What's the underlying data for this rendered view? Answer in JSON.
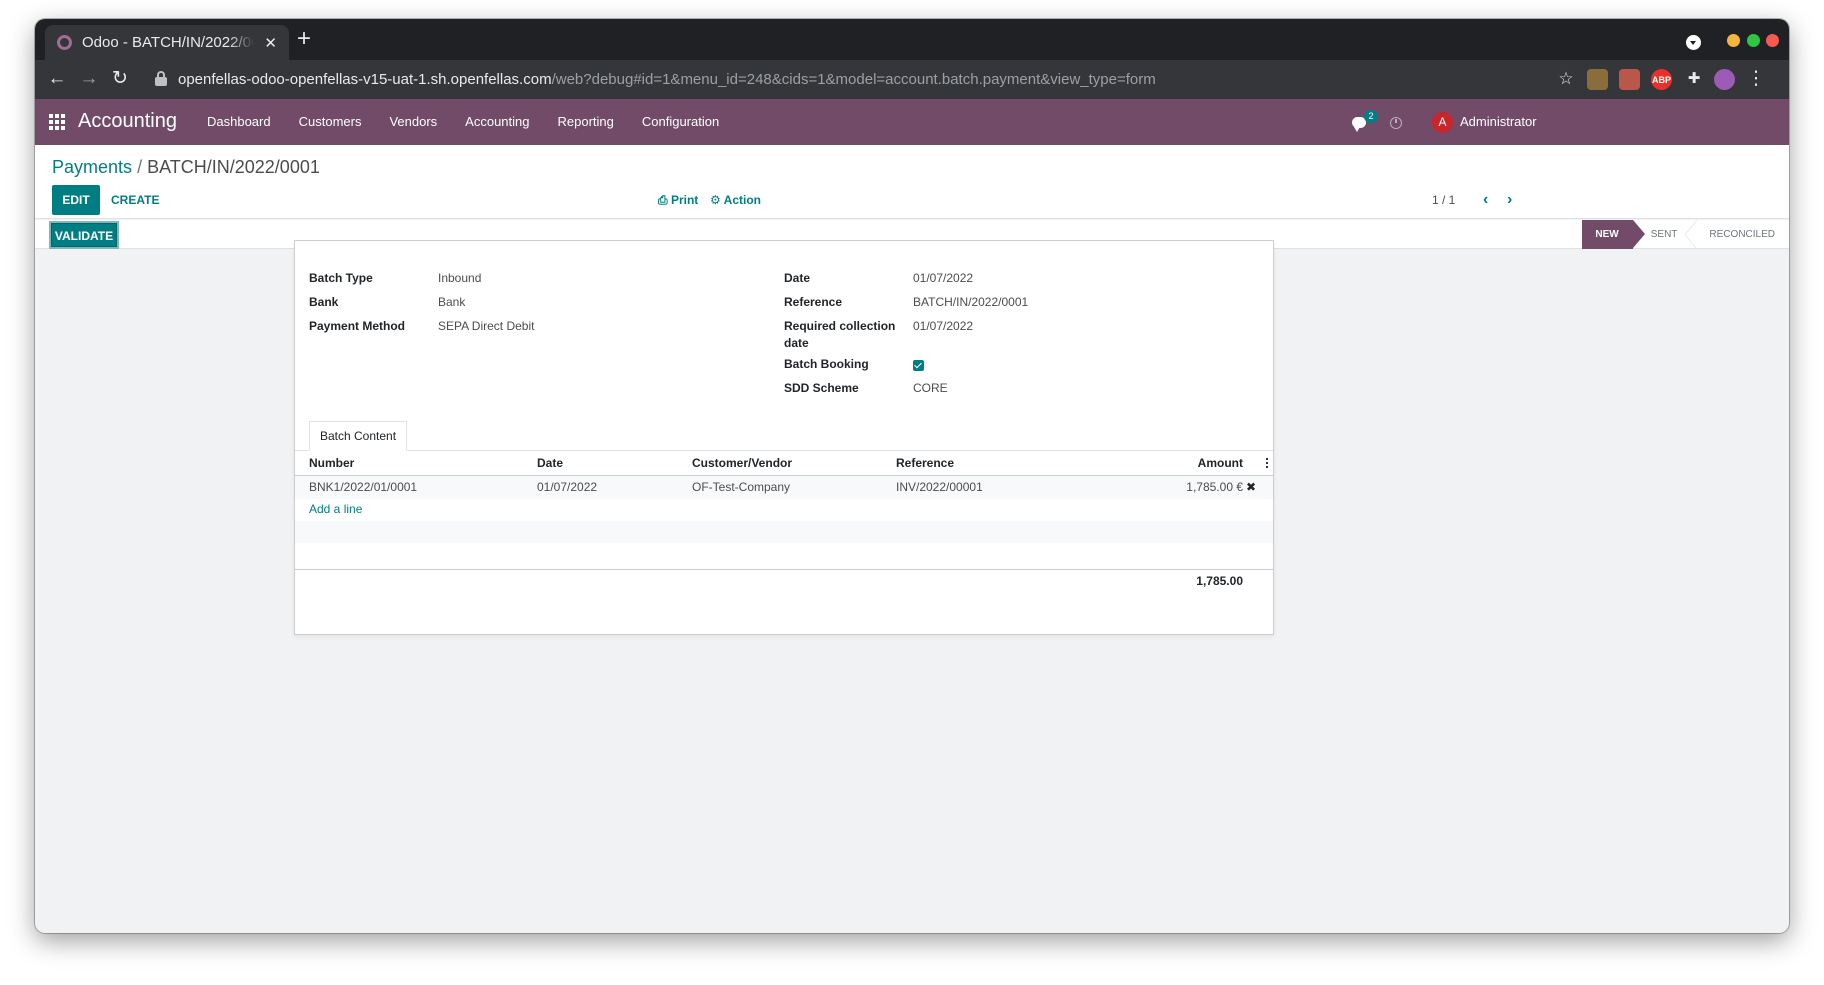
{
  "browser": {
    "tab_title": "Odoo - BATCH/IN/2022/0001",
    "url_host": "openfellas-odoo-openfellas-v15-uat-1.sh.openfellas.com",
    "url_path": "/web?debug#id=1&menu_id=248&cids=1&model=account.batch.payment&view_type=form",
    "extensions": [
      {
        "name": "extension-1-icon",
        "color": "#8a6d3b"
      },
      {
        "name": "extension-2-icon",
        "color": "#b8574a"
      },
      {
        "name": "adblock-icon",
        "label": "ABP",
        "color": "#e5322d"
      },
      {
        "name": "extensions-puzzle-icon",
        "color": "transparent"
      },
      {
        "name": "profile-avatar-icon",
        "color": "#9c5bb5"
      }
    ],
    "traffic_light_colors": [
      "#f5b43b",
      "#2fc642",
      "#f45a52"
    ]
  },
  "navbar": {
    "app_name": "Accounting",
    "menu": [
      "Dashboard",
      "Customers",
      "Vendors",
      "Accounting",
      "Reporting",
      "Configuration"
    ],
    "message_count": "2",
    "user_initial": "A",
    "user_name": "Administrator",
    "color": "#714b67"
  },
  "control_panel": {
    "breadcrumb_parent": "Payments",
    "breadcrumb_separator": "/",
    "breadcrumb_current": "BATCH/IN/2022/0001",
    "edit_label": "EDIT",
    "create_label": "CREATE",
    "print_label": "Print",
    "action_label": "Action",
    "pager": "1 / 1"
  },
  "statusbar": {
    "validate_label": "VALIDATE",
    "stages": [
      "NEW",
      "SENT",
      "RECONCILED"
    ],
    "active_stage": "NEW"
  },
  "form": {
    "left_fields": [
      {
        "label": "Batch Type",
        "value": "Inbound"
      },
      {
        "label": "Bank",
        "value": "Bank"
      },
      {
        "label": "Payment Method",
        "value": "SEPA Direct Debit"
      }
    ],
    "right_fields": {
      "date_label": "Date",
      "date_value": "01/07/2022",
      "reference_label": "Reference",
      "reference_value": "BATCH/IN/2022/0001",
      "collection_label_line1": "Required collection",
      "collection_label_line2": "date",
      "collection_value": "01/07/2022",
      "batch_booking_label": "Batch Booking",
      "batch_booking_checked": true,
      "sdd_label": "SDD Scheme",
      "sdd_value": "CORE"
    },
    "notebook_tab": "Batch Content",
    "table": {
      "columns": [
        "Number",
        "Date",
        "Customer/Vendor",
        "Reference",
        "Amount"
      ],
      "rows": [
        [
          "BNK1/2022/01/0001",
          "01/07/2022",
          "OF-Test-Company",
          "INV/2022/00001",
          "1,785.00 €"
        ]
      ],
      "add_line_label": "Add a line",
      "total": "1,785.00"
    },
    "accent_color": "#017e84"
  }
}
